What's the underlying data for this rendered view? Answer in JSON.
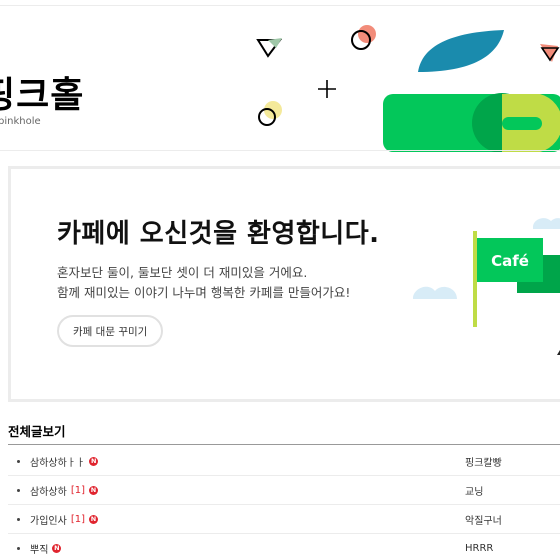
{
  "header": {
    "cafe_name": "핑크홀",
    "cafe_url": "pinkhole"
  },
  "colors": {
    "accent_green": "#03c75a",
    "light_green": "#bfdc46",
    "teal": "#1a8bad",
    "coral": "#f28c7a",
    "new_badge": "#e0242e"
  },
  "banner": {
    "title": "카페에 오신것을 환영합니다.",
    "desc_line1": "혼자보단 둘이, 둘보단 셋이 더 재미있을 거에요.",
    "desc_line2": "함께 재미있는 이야기 나누며 행복한 카페를 만들어가요!",
    "decorate_button": "카페 대문 꾸미기",
    "flag_label": "Café"
  },
  "list": {
    "title": "전체글보기",
    "rows": [
      {
        "title": "삼하상하ㅏㅏ",
        "comments": "",
        "new": "N",
        "author": "핑크칼빵"
      },
      {
        "title": "삼하상하",
        "comments": "[1]",
        "new": "N",
        "author": "교닝"
      },
      {
        "title": "가입인사",
        "comments": "[1]",
        "new": "N",
        "author": "악질구너"
      },
      {
        "title": "뿌직",
        "comments": "",
        "new": "N",
        "author": "HRRR"
      }
    ]
  }
}
